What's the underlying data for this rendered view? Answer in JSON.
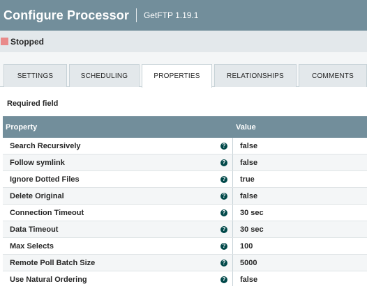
{
  "header": {
    "title": "Configure Processor",
    "subtitle": "GetFTP 1.19.1"
  },
  "status": {
    "label": "Stopped",
    "color": "#e98a8a"
  },
  "tabs": [
    {
      "label": "SETTINGS",
      "active": false
    },
    {
      "label": "SCHEDULING",
      "active": false
    },
    {
      "label": "PROPERTIES",
      "active": true
    },
    {
      "label": "RELATIONSHIPS",
      "active": false
    },
    {
      "label": "COMMENTS",
      "active": false
    }
  ],
  "required_label": "Required field",
  "grid": {
    "columns": [
      "Property",
      "Value"
    ],
    "rows": [
      {
        "name": "Search Recursively",
        "value": "false"
      },
      {
        "name": "Follow symlink",
        "value": "false"
      },
      {
        "name": "Ignore Dotted Files",
        "value": "true"
      },
      {
        "name": "Delete Original",
        "value": "false"
      },
      {
        "name": "Connection Timeout",
        "value": "30 sec"
      },
      {
        "name": "Data Timeout",
        "value": "30 sec"
      },
      {
        "name": "Max Selects",
        "value": "100"
      },
      {
        "name": "Remote Poll Batch Size",
        "value": "5000"
      },
      {
        "name": "Use Natural Ordering",
        "value": "false"
      }
    ],
    "help_icon": "?"
  },
  "colors": {
    "header": "#728e9b",
    "accent": "#004849"
  }
}
